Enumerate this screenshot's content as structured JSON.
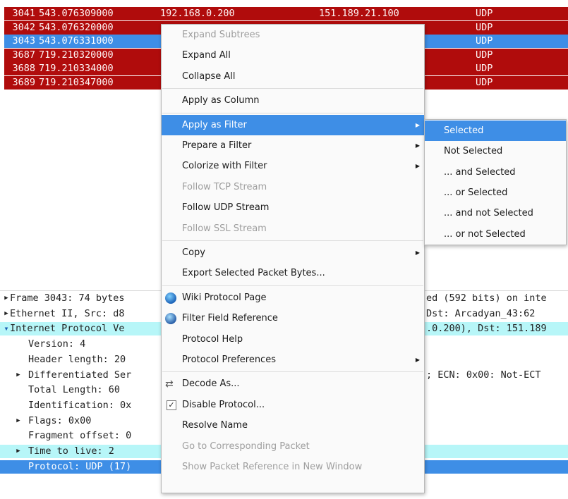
{
  "colors": {
    "red_row_bg": "#b00c0c",
    "red_row_fg": "#fff6f6",
    "selected_row_bg": "#3e8ee6",
    "cyan_row_bg": "#b7f6f8",
    "menu_highlight": "#3e8ee6"
  },
  "packets": [
    {
      "no": "3041",
      "time": "543.076309000",
      "src": "192.168.0.200",
      "dst": "151.189.21.100",
      "proto": "UDP",
      "style": "red"
    },
    {
      "no": "3042",
      "time": "543.076320000",
      "src": "",
      "dst": "",
      "proto": "UDP",
      "style": "red"
    },
    {
      "no": "3043",
      "time": "543.076331000",
      "src": "",
      "dst": "",
      "proto": "UDP",
      "style": "selected"
    },
    {
      "no": "3687",
      "time": "719.210320000",
      "src": "",
      "dst": "",
      "proto": "UDP",
      "style": "red"
    },
    {
      "no": "3688",
      "time": "719.210334000",
      "src": "",
      "dst": "",
      "proto": "UDP",
      "style": "red"
    },
    {
      "no": "3689",
      "time": "719.210347000",
      "src": "",
      "dst": "",
      "proto": "UDP",
      "style": "red"
    }
  ],
  "details": [
    {
      "text": "Frame 3043: 74 bytes",
      "tail": "ed (592 bits) on inte",
      "arrow": "right",
      "indent": 0,
      "style": "normal"
    },
    {
      "text": "Ethernet II, Src: d8",
      "tail": "Dst: Arcadyan_43:62",
      "arrow": "right",
      "indent": 0,
      "style": "normal"
    },
    {
      "text": "Internet Protocol Ve",
      "tail": ".0.200), Dst: 151.189",
      "arrow": "down",
      "indent": 0,
      "style": "cyan"
    },
    {
      "text": "Version: 4",
      "tail": "",
      "arrow": "",
      "indent": 1,
      "style": "normal"
    },
    {
      "text": "Header length: 20",
      "tail": "",
      "arrow": "",
      "indent": 1,
      "style": "normal"
    },
    {
      "text": "Differentiated Ser",
      "tail": "; ECN: 0x00: Not-ECT",
      "arrow": "right",
      "indent": 1,
      "style": "normal"
    },
    {
      "text": "Total Length: 60",
      "tail": "",
      "arrow": "",
      "indent": 1,
      "style": "normal"
    },
    {
      "text": "Identification: 0x",
      "tail": "",
      "arrow": "",
      "indent": 1,
      "style": "normal"
    },
    {
      "text": "Flags: 0x00",
      "tail": "",
      "arrow": "right",
      "indent": 1,
      "style": "normal"
    },
    {
      "text": "Fragment offset: 0",
      "tail": "",
      "arrow": "",
      "indent": 1,
      "style": "normal"
    },
    {
      "text": "Time to live: 2",
      "tail": "",
      "arrow": "right",
      "indent": 1,
      "style": "cyan"
    },
    {
      "text": "Protocol: UDP (17)",
      "tail": "",
      "arrow": "",
      "indent": 1,
      "style": "selected"
    }
  ],
  "context_menu": {
    "items": [
      {
        "label": "Expand Subtrees",
        "disabled": true
      },
      {
        "label": "Expand All"
      },
      {
        "label": "Collapse All"
      },
      {
        "sep": true
      },
      {
        "label": "Apply as Column"
      },
      {
        "sep": true
      },
      {
        "label": "Apply as Filter",
        "submenu": true,
        "highlighted": true
      },
      {
        "label": "Prepare a Filter",
        "submenu": true
      },
      {
        "label": "Colorize with Filter",
        "submenu": true
      },
      {
        "label": "Follow TCP Stream",
        "disabled": true
      },
      {
        "label": "Follow UDP Stream"
      },
      {
        "label": "Follow SSL Stream",
        "disabled": true
      },
      {
        "sep": true
      },
      {
        "label": "Copy",
        "submenu": true
      },
      {
        "label": "Export Selected Packet Bytes..."
      },
      {
        "sep": true
      },
      {
        "label": "Wiki Protocol Page",
        "icon": "globe-icon"
      },
      {
        "label": "Filter Field Reference",
        "icon": "globe-info-icon"
      },
      {
        "label": "Protocol Help"
      },
      {
        "label": "Protocol Preferences",
        "submenu": true
      },
      {
        "sep": true
      },
      {
        "label": "Decode As...",
        "icon": "decode-as-icon"
      },
      {
        "label": "Disable Protocol...",
        "icon": "checkbox-icon",
        "checked": true
      },
      {
        "label": "Resolve Name"
      },
      {
        "label": "Go to Corresponding Packet",
        "disabled": true
      },
      {
        "label": "Show Packet Reference in New Window",
        "disabled": true
      }
    ]
  },
  "filter_submenu": {
    "items": [
      {
        "label": "Selected",
        "highlighted": true
      },
      {
        "label": "Not Selected"
      },
      {
        "label": "... and Selected"
      },
      {
        "label": "... or Selected"
      },
      {
        "label": "... and not Selected"
      },
      {
        "label": "... or not Selected"
      }
    ]
  }
}
